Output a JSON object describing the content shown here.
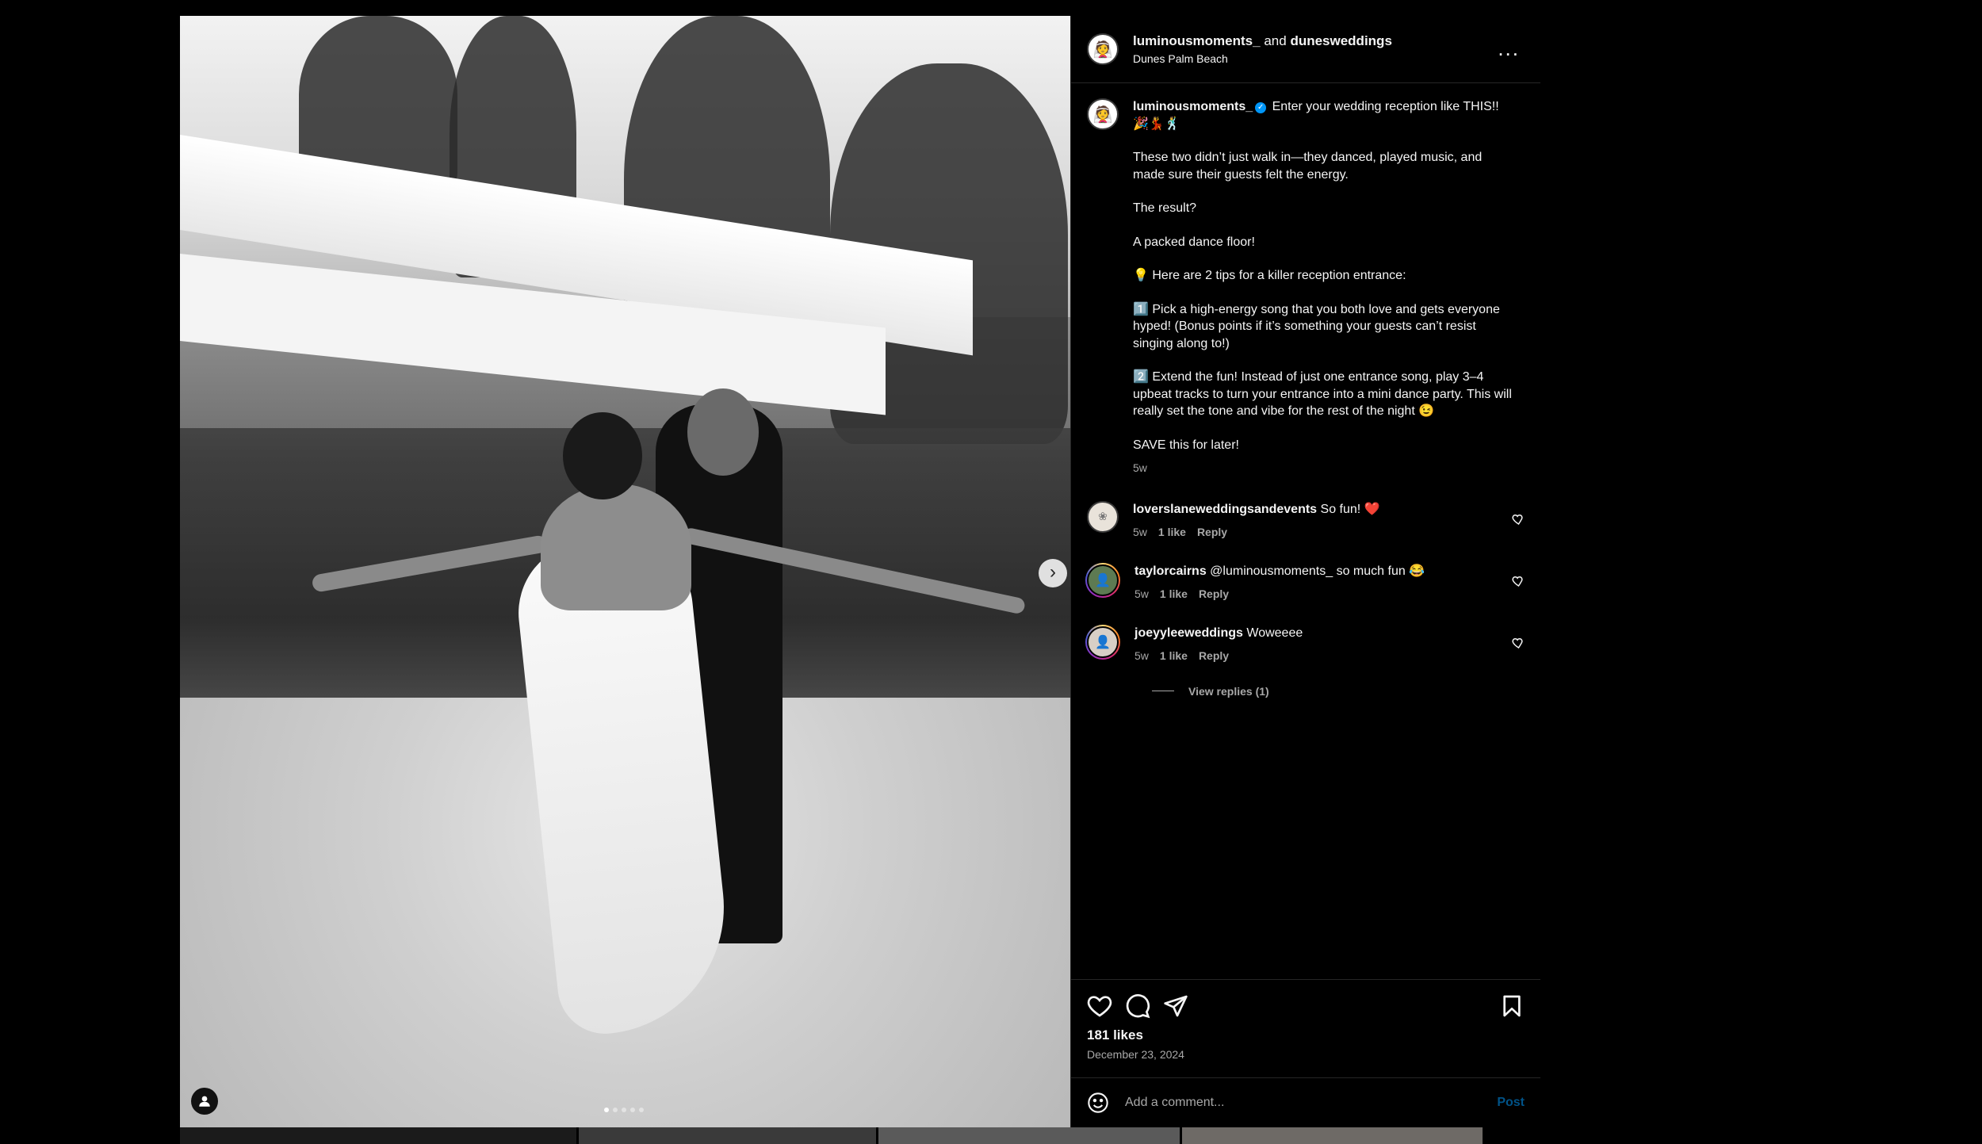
{
  "post": {
    "header": {
      "author": "luminousmoments_",
      "joiner": "and",
      "collaborator": "dunesweddings",
      "location": "Dunes Palm Beach",
      "more_label": "..."
    },
    "caption": {
      "author": "luminousmoments_",
      "verified_mark": "✓",
      "first_line": "Enter your wedding reception like THIS!! 🎉💃🕺",
      "paragraphs": [
        "These two didn’t just walk in—they danced, played music, and made sure their guests felt the energy.",
        "The result?",
        "A packed dance floor!",
        "💡 Here are 2 tips for a killer reception entrance:",
        "1️⃣ Pick a high-energy song that you both love and gets everyone hyped! (Bonus points if it’s something your guests can’t resist singing along to!)",
        "2️⃣ Extend the fun! Instead of just one entrance song, play 3–4 upbeat tracks to turn your entrance into a mini dance party. This will really set the tone and vibe for the rest of the night 😉",
        "SAVE this for later!"
      ],
      "age": "5w"
    },
    "comments": [
      {
        "username": "loverslaneweddingsandevents",
        "text": "So fun! ❤️",
        "age": "5w",
        "likes": "1 like",
        "reply_label": "Reply"
      },
      {
        "username": "taylorcairns",
        "text": "@luminousmoments_ so much fun 😂",
        "age": "5w",
        "likes": "1 like",
        "reply_label": "Reply"
      },
      {
        "username": "joeyyleeweddings",
        "text": "Woweeee",
        "age": "5w",
        "likes": "1 like",
        "reply_label": "Reply"
      }
    ],
    "view_replies_label": "View replies (1)",
    "likes_label": "181 likes",
    "date": "December 23, 2024",
    "comment_input": {
      "placeholder": "Add a comment...",
      "value": ""
    },
    "post_button_label": "Post",
    "carousel": {
      "slide_count": 5,
      "active_index": 0,
      "next_glyph": "›"
    }
  },
  "colors": {
    "accent": "#0095f6",
    "background": "#000000",
    "muted_text": "#a8a8a8",
    "divider": "#262626"
  },
  "icons": [
    "more-icon",
    "verified-icon",
    "heart-icon",
    "comment-icon",
    "share-icon",
    "bookmark-icon",
    "emoji-icon",
    "user-tag-icon",
    "chevron-right-icon"
  ]
}
